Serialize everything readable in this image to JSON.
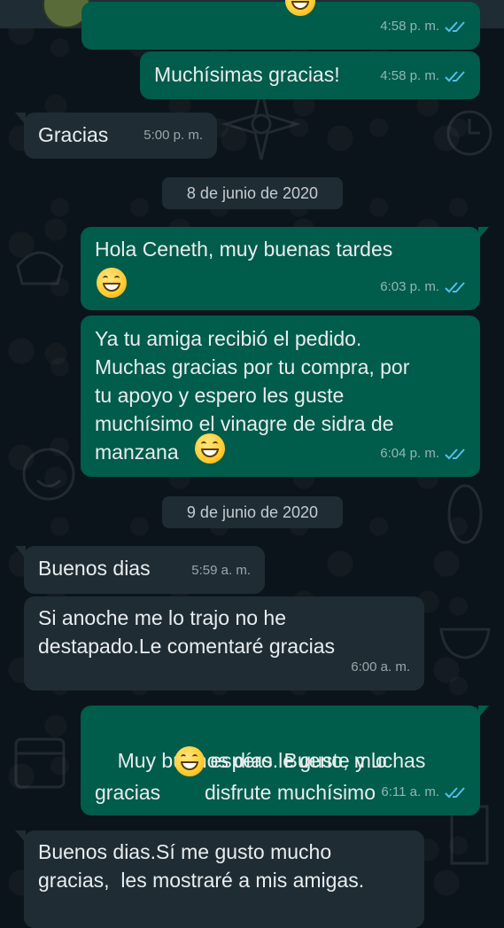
{
  "colors": {
    "background": "#0b141a",
    "outgoing_bubble": "#005c4b",
    "incoming_bubble": "#1f2c34",
    "text": "#e9edef",
    "read_ticks": "#53bdeb"
  },
  "messages": [
    {
      "direction": "out",
      "text": "",
      "time": "4:58 p. m.",
      "status": "read",
      "emoji": true
    },
    {
      "direction": "out",
      "text": "Muchísimas gracias!",
      "time": "4:58 p. m.",
      "status": "read"
    },
    {
      "direction": "in",
      "text": "Gracias",
      "time": "5:00 p. m."
    },
    {
      "direction": "date",
      "text": "8 de junio de 2020"
    },
    {
      "direction": "out",
      "text": "Hola Ceneth, muy buenas tardes",
      "time": "6:03 p. m.",
      "status": "read",
      "emoji": true
    },
    {
      "direction": "out",
      "text": "Ya tu amiga recibió el pedido.\nMuchas gracias por tu compra, por\ntu apoyo y espero les guste\nmuchísimo el vinagre de sidra de\nmanzana",
      "time": "6:04 p. m.",
      "status": "read",
      "emoji": true
    },
    {
      "direction": "date",
      "text": "9 de junio de 2020"
    },
    {
      "direction": "in",
      "text": "Buenos dias",
      "time": "5:59 a. m."
    },
    {
      "direction": "in",
      "text": "Si anoche me lo trajo no he\ndestapado.Le comentaré gracias",
      "time": "6:00 a. m."
    },
    {
      "direction": "out",
      "text_before_emoji": "Muy buenos días. Bueno, muchas\ngracias",
      "text_after_emoji": " espero le guste y lo\ndisfrute muchísimo",
      "time": "6:11 a. m.",
      "status": "read"
    },
    {
      "direction": "in",
      "text": "Buenos dias.Sí me gusto mucho\ngracias,  les mostraré a mis amigas."
    }
  ]
}
